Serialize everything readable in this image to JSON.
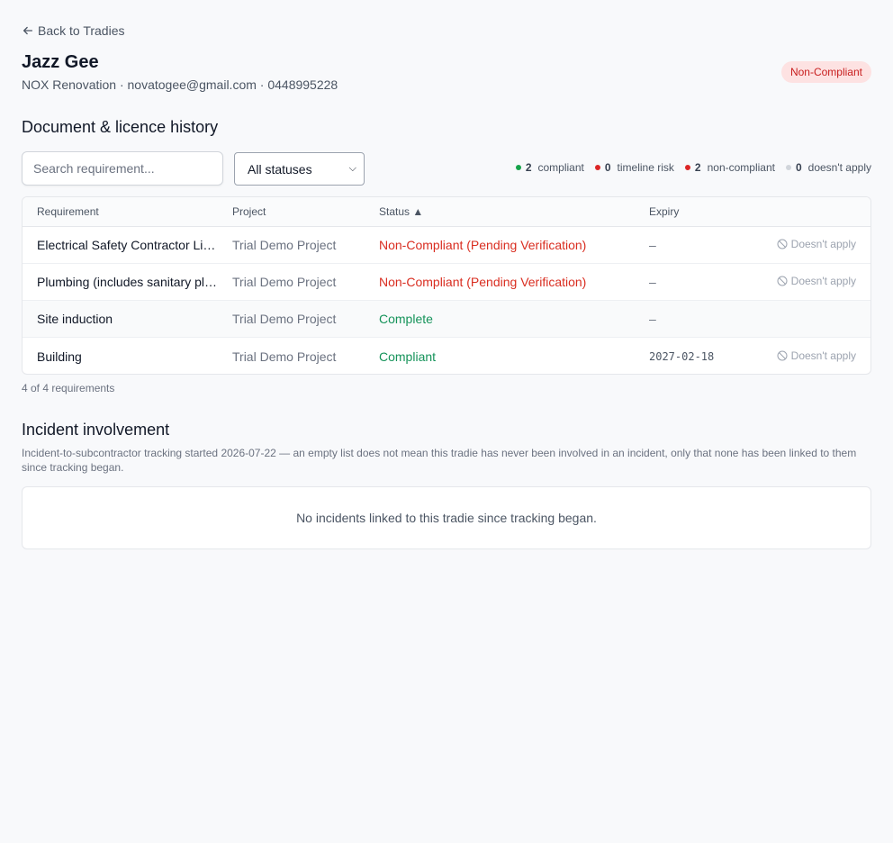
{
  "nav": {
    "back_label": "Back to Tradies"
  },
  "tradie": {
    "name": "Jazz Gee",
    "meta": "NOX Renovation · novatogee@gmail.com · 0448995228",
    "status": "Non-Compliant"
  },
  "documents": {
    "title": "Document & licence history",
    "search_placeholder": "Search requirement...",
    "status_filter": "All statuses",
    "legend": [
      {
        "count": "2",
        "label": "compliant",
        "color": "#16a34a"
      },
      {
        "count": "0",
        "label": "timeline risk",
        "color": "#dc2626"
      },
      {
        "count": "2",
        "label": "non-compliant",
        "color": "#dc2626"
      },
      {
        "count": "0",
        "label": "doesn't apply",
        "color": "#d1d5db"
      }
    ],
    "columns": {
      "requirement": "Requirement",
      "project": "Project",
      "status": "Status ▲",
      "expiry": "Expiry"
    },
    "rows": [
      {
        "requirement": "Electrical Safety Contractor Licence",
        "project": "Trial Demo Project",
        "status": "Non-Compliant (Pending Verification)",
        "expiry": "–",
        "action": "Doesn't apply"
      },
      {
        "requirement": "Plumbing (includes sanitary plumbing)",
        "project": "Trial Demo Project",
        "status": "Non-Compliant (Pending Verification)",
        "expiry": "–",
        "action": "Doesn't apply"
      },
      {
        "requirement": "Site induction",
        "project": "Trial Demo Project",
        "status": "Complete",
        "expiry": "–",
        "action": ""
      },
      {
        "requirement": "Building",
        "project": "Trial Demo Project",
        "status": "Compliant",
        "expiry": "2027-02-18",
        "action": "Doesn't apply"
      }
    ],
    "count_text": "4 of 4 requirements"
  },
  "incidents": {
    "title": "Incident involvement",
    "note": "Incident-to-subcontractor tracking started 2026-07-22 — an empty list does not mean this tradie has never been involved in an incident, only that none has been linked to them since tracking began.",
    "empty_text": "No incidents linked to this tradie since tracking began."
  }
}
